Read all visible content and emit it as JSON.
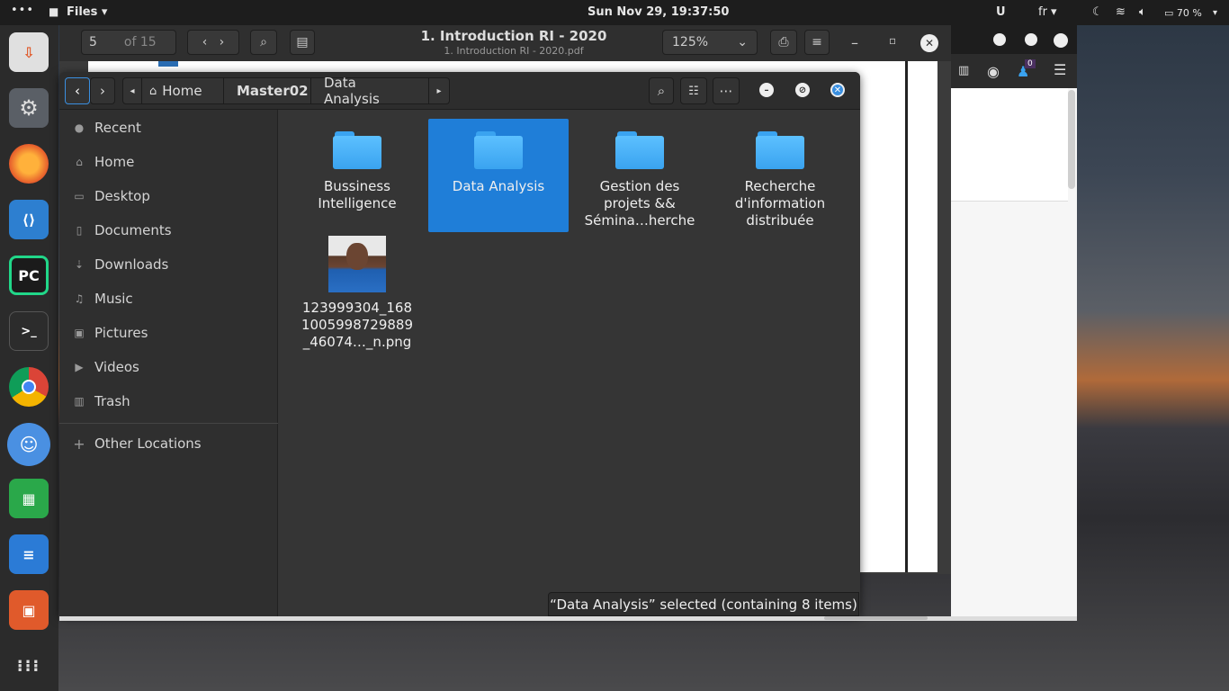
{
  "topbar": {
    "activities_glyph": "•••",
    "app_name": "Files ▾",
    "clock": "Sun Nov 29, 19:37:50",
    "lang": "fr ▾",
    "battery": "70 %"
  },
  "pdf": {
    "page_value": "5",
    "page_of": "of 15",
    "title": "1. Introduction RI - 2020",
    "subtitle": "1. Introduction RI - 2020.pdf",
    "zoom": "125%"
  },
  "firefox": {
    "badge": "0"
  },
  "files": {
    "breadcrumb": {
      "home": "Home",
      "parent": "Master02",
      "current": "Data Analysis"
    },
    "sidebar": [
      {
        "label": "Recent",
        "icon": "clock-icon"
      },
      {
        "label": "Home",
        "icon": "home-icon"
      },
      {
        "label": "Desktop",
        "icon": "desktop-icon"
      },
      {
        "label": "Documents",
        "icon": "document-icon"
      },
      {
        "label": "Downloads",
        "icon": "download-icon"
      },
      {
        "label": "Music",
        "icon": "music-icon"
      },
      {
        "label": "Pictures",
        "icon": "picture-icon"
      },
      {
        "label": "Videos",
        "icon": "video-icon"
      },
      {
        "label": "Trash",
        "icon": "trash-icon"
      }
    ],
    "other_locations": "Other Locations",
    "items": [
      {
        "line1": "Bussiness",
        "line2": "Intelligence",
        "line3": ""
      },
      {
        "line1": "Data Analysis",
        "line2": "",
        "line3": ""
      },
      {
        "line1": "Gestion des",
        "line2": "projets &&",
        "line3": "Sémina…herche"
      },
      {
        "line1": "Recherche",
        "line2": "d'information",
        "line3": "distribuée"
      },
      {
        "line1": "123999304_168",
        "line2": "1005998729889",
        "line3": "_46074…_n.png"
      }
    ],
    "status": "“Data Analysis” selected  (containing 8 items)"
  },
  "colors": {
    "selection": "#1f7ed8",
    "folder": "#3aa3f0"
  }
}
